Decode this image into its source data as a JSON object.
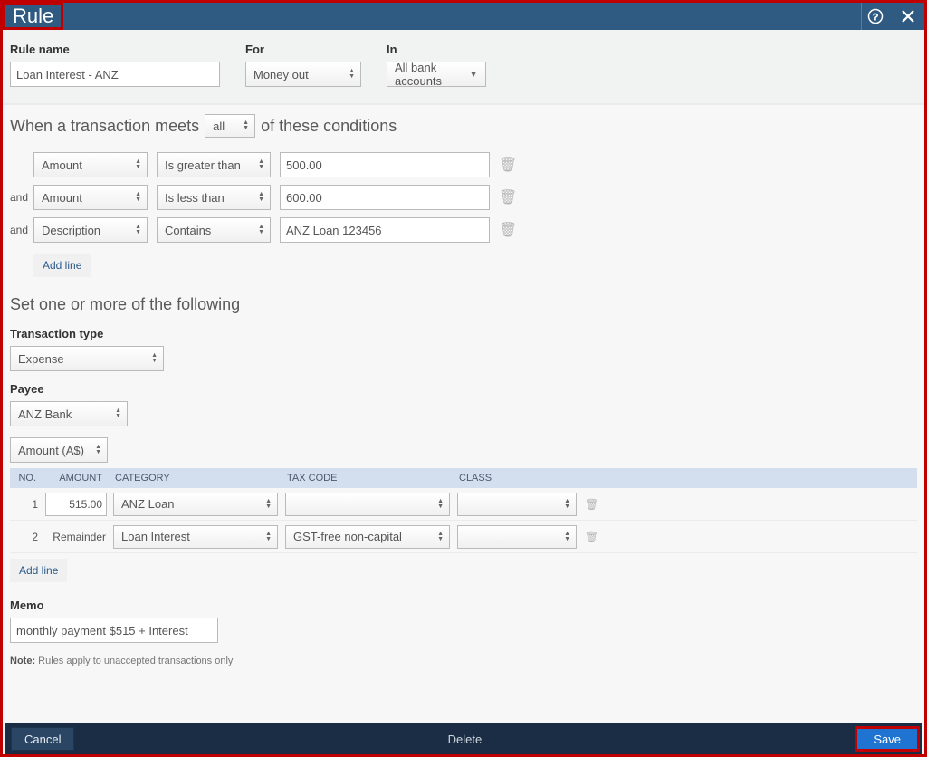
{
  "title": "Rule",
  "header": {
    "rule_name_label": "Rule name",
    "rule_name_value": "Loan Interest - ANZ",
    "for_label": "For",
    "for_value": "Money out",
    "in_label": "In",
    "in_value": "All bank accounts"
  },
  "conditions": {
    "prefix": "When a transaction meets",
    "match": "all",
    "suffix": "of these conditions",
    "and_label": "and",
    "add_line": "Add line",
    "rows": [
      {
        "field": "Amount",
        "op": "Is greater than",
        "value": "500.00"
      },
      {
        "field": "Amount",
        "op": "Is less than",
        "value": "600.00"
      },
      {
        "field": "Description",
        "op": "Contains",
        "value": "ANZ Loan 123456"
      }
    ]
  },
  "set": {
    "title": "Set one or more of the following",
    "tx_type_label": "Transaction type",
    "tx_type_value": "Expense",
    "payee_label": "Payee",
    "payee_value": "ANZ Bank",
    "amount_header": "Amount (A$)",
    "table": {
      "headers": {
        "no": "NO.",
        "amount": "AMOUNT",
        "category": "CATEGORY",
        "tax": "TAX CODE",
        "class": "CLASS"
      },
      "rows": [
        {
          "no": "1",
          "amount": "515.00",
          "category": "ANZ Loan",
          "tax": "",
          "class": ""
        },
        {
          "no": "2",
          "amount": "Remainder",
          "category": "Loan Interest",
          "tax": "GST-free non-capital",
          "class": ""
        }
      ]
    },
    "add_line": "Add line"
  },
  "memo": {
    "label": "Memo",
    "value": "monthly payment $515 + Interest"
  },
  "note_prefix": "Note:",
  "note_text": "Rules apply to unaccepted transactions only",
  "footer": {
    "cancel": "Cancel",
    "delete": "Delete",
    "save": "Save"
  },
  "chart_data": null
}
